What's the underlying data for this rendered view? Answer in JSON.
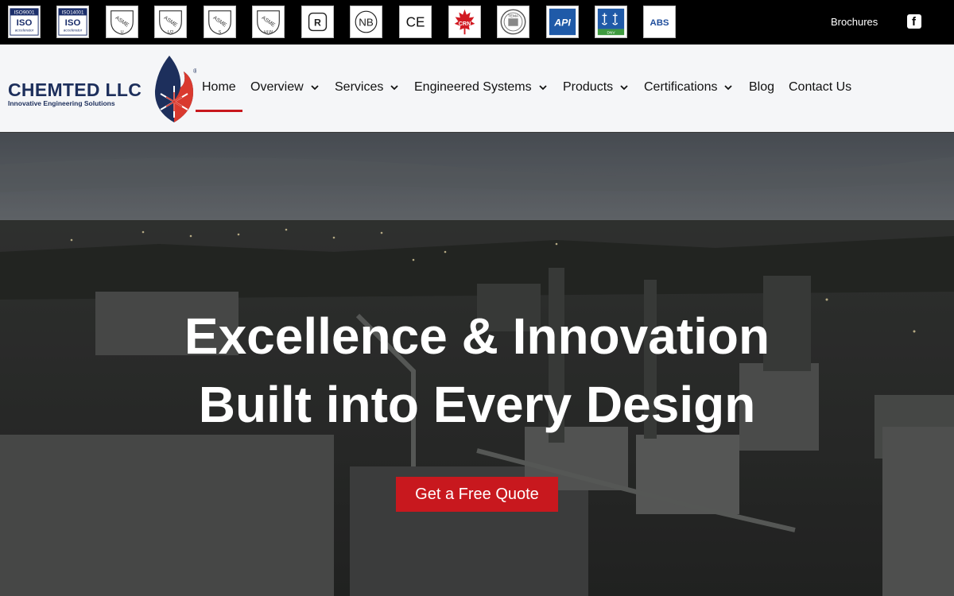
{
  "certifications": [
    {
      "name": "iso9001-icon",
      "line1": "ISO9001",
      "line2": "ISO",
      "line3": "accelerator"
    },
    {
      "name": "iso14001-icon",
      "line1": "ISO14001",
      "line2": "ISO",
      "line3": "accelerator"
    },
    {
      "name": "asme-u-icon",
      "mark": "ASME",
      "stamp": "U"
    },
    {
      "name": "asme-u2-icon",
      "mark": "ASME",
      "stamp": "U2"
    },
    {
      "name": "asme-s-icon",
      "mark": "ASME",
      "stamp": "S"
    },
    {
      "name": "asme-hlw-icon",
      "mark": "ASME",
      "stamp": "HLW"
    },
    {
      "name": "r-stamp-icon",
      "mark": "R"
    },
    {
      "name": "nb-icon",
      "mark": "NB"
    },
    {
      "name": "ce-icon",
      "mark": "CE"
    },
    {
      "name": "crn-icon",
      "mark": "CRN"
    },
    {
      "name": "tema-icon",
      "mark": "TEMA"
    },
    {
      "name": "api-icon",
      "mark": "API"
    },
    {
      "name": "dnv-icon",
      "mark": "DNV"
    },
    {
      "name": "abs-icon",
      "mark": "ABS"
    }
  ],
  "topbar": {
    "brochures_label": "Brochures",
    "facebook_label": "f"
  },
  "brand": {
    "name": "CHEMTED LLC",
    "tagline": "Innovative Engineering Solutions",
    "registered": "®"
  },
  "nav": {
    "items": [
      {
        "label": "Home",
        "has_dropdown": false,
        "active": true
      },
      {
        "label": "Overview",
        "has_dropdown": true
      },
      {
        "label": "Services",
        "has_dropdown": true
      },
      {
        "label": "Engineered Systems",
        "has_dropdown": true
      },
      {
        "label": "Products",
        "has_dropdown": true
      },
      {
        "label": "Certifications",
        "has_dropdown": true
      },
      {
        "label": "Blog",
        "has_dropdown": false
      },
      {
        "label": "Contact Us",
        "has_dropdown": false
      }
    ]
  },
  "hero": {
    "title_line1": "Excellence & Innovation",
    "title_line2": "Built into Every Design",
    "cta_label": "Get a Free Quote"
  },
  "colors": {
    "accent": "#c8181e",
    "brand_navy": "#1d2f5c",
    "topbar_bg": "#000000",
    "header_bg": "#f5f6f8"
  }
}
